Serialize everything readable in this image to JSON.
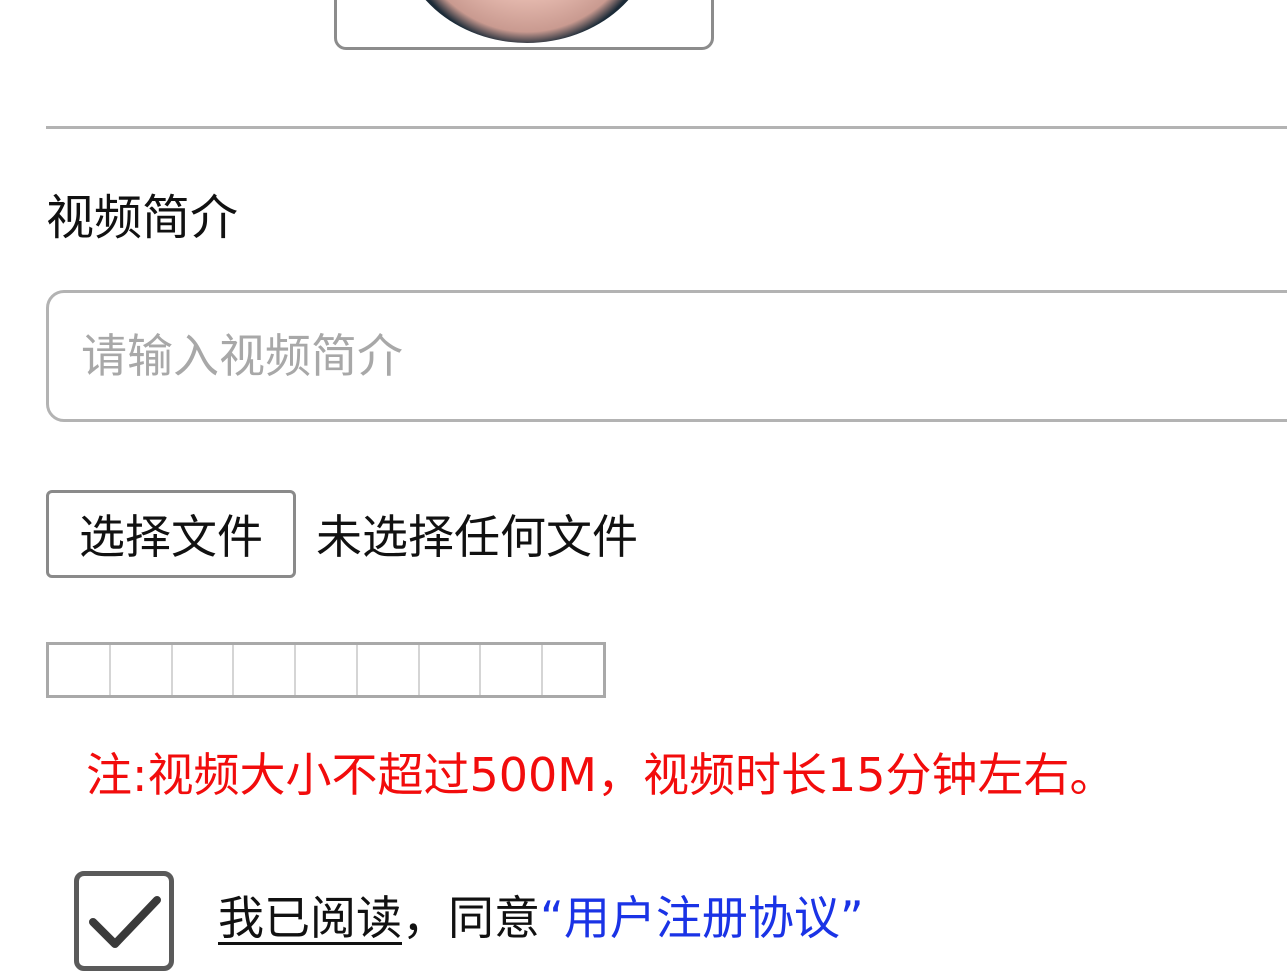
{
  "cover": {
    "alt": "avatar"
  },
  "intro": {
    "label": "视频简介",
    "placeholder": "请输入视频简介"
  },
  "file": {
    "button_label": "选择文件",
    "status": "未选择任何文件"
  },
  "progress": {
    "value": 0,
    "segments": 9
  },
  "note": {
    "text": "注:视频大小不超过500M，视频时长15分钟左右。",
    "color": "#f20c0c"
  },
  "agreement": {
    "checked": true,
    "read_text": "我已阅读",
    "comma": "，同意",
    "open_quote": "“",
    "link_text": "用户注册协议",
    "close_quote": "”",
    "link_color": "#1a33e6"
  }
}
